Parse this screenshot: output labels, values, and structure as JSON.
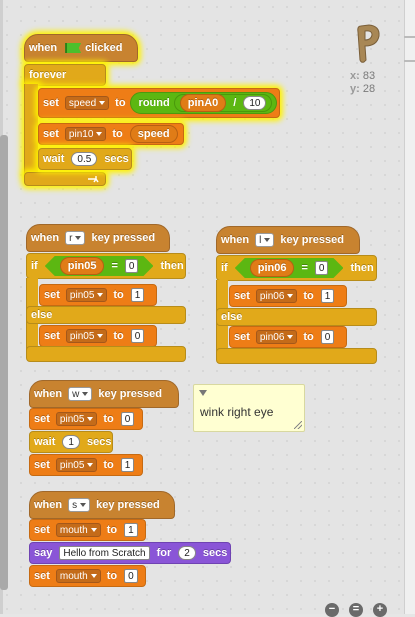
{
  "sprite_info": {
    "x_label": "x:",
    "x_value": "83",
    "y_label": "y:",
    "y_value": "28"
  },
  "script1": {
    "hat": {
      "when": "when",
      "clicked": "clicked"
    },
    "forever": "forever",
    "set1": {
      "set": "set",
      "var": "speed",
      "to": "to"
    },
    "round": "round",
    "pin": "pinA0",
    "div": "/",
    "divisor": "10",
    "set2": {
      "set": "set",
      "var": "pin10",
      "to": "to",
      "val": "speed"
    },
    "wait": {
      "wait": "wait",
      "val": "0.5",
      "secs": "secs"
    }
  },
  "script2": {
    "hat": {
      "when": "when",
      "key": "r",
      "pressed": "key pressed"
    },
    "if": "if",
    "var": "pin05",
    "eq": "=",
    "val": "0",
    "then": "then",
    "set1": {
      "set": "set",
      "var": "pin05",
      "to": "to",
      "val": "1"
    },
    "else": "else",
    "set2": {
      "set": "set",
      "var": "pin05",
      "to": "to",
      "val": "0"
    }
  },
  "script3": {
    "hat": {
      "when": "when",
      "key": "l",
      "pressed": "key pressed"
    },
    "if": "if",
    "var": "pin06",
    "eq": "=",
    "val": "0",
    "then": "then",
    "set1": {
      "set": "set",
      "var": "pin06",
      "to": "to",
      "val": "1"
    },
    "else": "else",
    "set2": {
      "set": "set",
      "var": "pin06",
      "to": "to",
      "val": "0"
    }
  },
  "script4": {
    "hat": {
      "when": "when",
      "key": "w",
      "pressed": "key pressed"
    },
    "set1": {
      "set": "set",
      "var": "pin05",
      "to": "to",
      "val": "0"
    },
    "wait": {
      "wait": "wait",
      "val": "1",
      "secs": "secs"
    },
    "set2": {
      "set": "set",
      "var": "pin05",
      "to": "to",
      "val": "1"
    }
  },
  "comment": "wink right eye",
  "script5": {
    "hat": {
      "when": "when",
      "key": "s",
      "pressed": "key pressed"
    },
    "set1": {
      "set": "set",
      "var": "mouth",
      "to": "to",
      "val": "1"
    },
    "say": {
      "say": "say",
      "text": "Hello from Scratch",
      "for": "for",
      "val": "2",
      "secs": "secs"
    },
    "set2": {
      "set": "set",
      "var": "mouth",
      "to": "to",
      "val": "0"
    }
  },
  "zoom": {
    "out": "−",
    "reset": "=",
    "in": "+"
  }
}
